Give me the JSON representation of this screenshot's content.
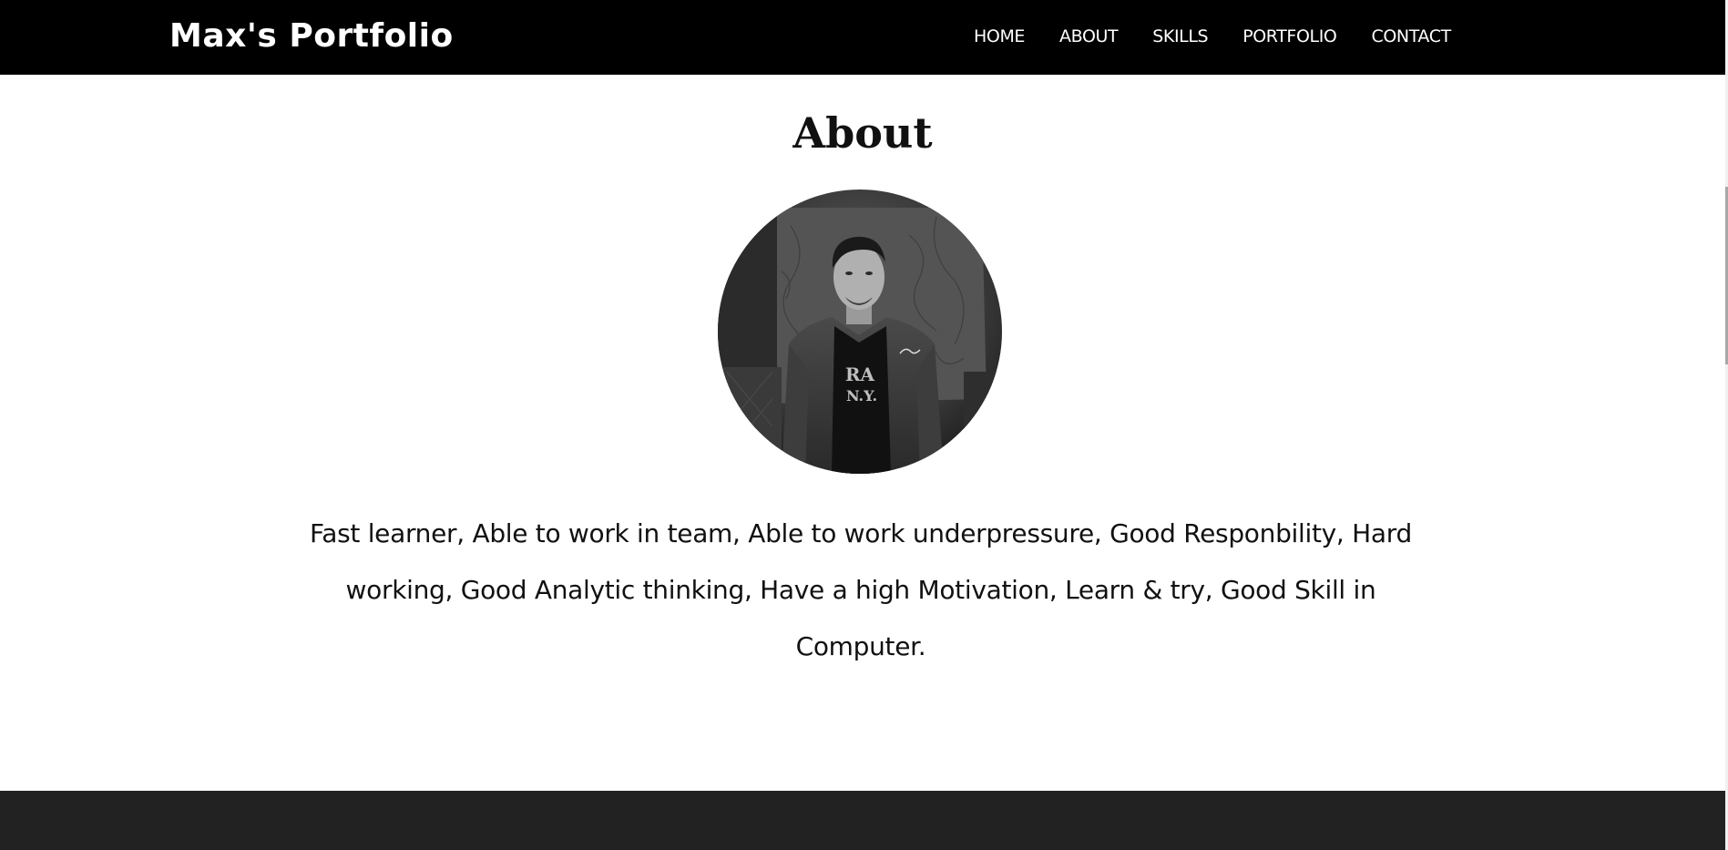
{
  "header": {
    "brand": "Max's Portfolio",
    "nav": [
      {
        "label": "HOME"
      },
      {
        "label": "ABOUT"
      },
      {
        "label": "SKILLS"
      },
      {
        "label": "PORTFOLIO"
      },
      {
        "label": "CONTACT"
      }
    ]
  },
  "about": {
    "title": "About",
    "photo_icon": "profile-photo",
    "description": "Fast learner, Able to work in team, Able to work underpressure, Good Responbility, Hard working, Good Analytic thinking, Have a high Motivation, Learn & try, Good Skill in Computer."
  },
  "colors": {
    "navbar_bg": "#000000",
    "nav_text": "#ffffff",
    "page_bg": "#ffffff",
    "footer_bg": "#222222"
  }
}
